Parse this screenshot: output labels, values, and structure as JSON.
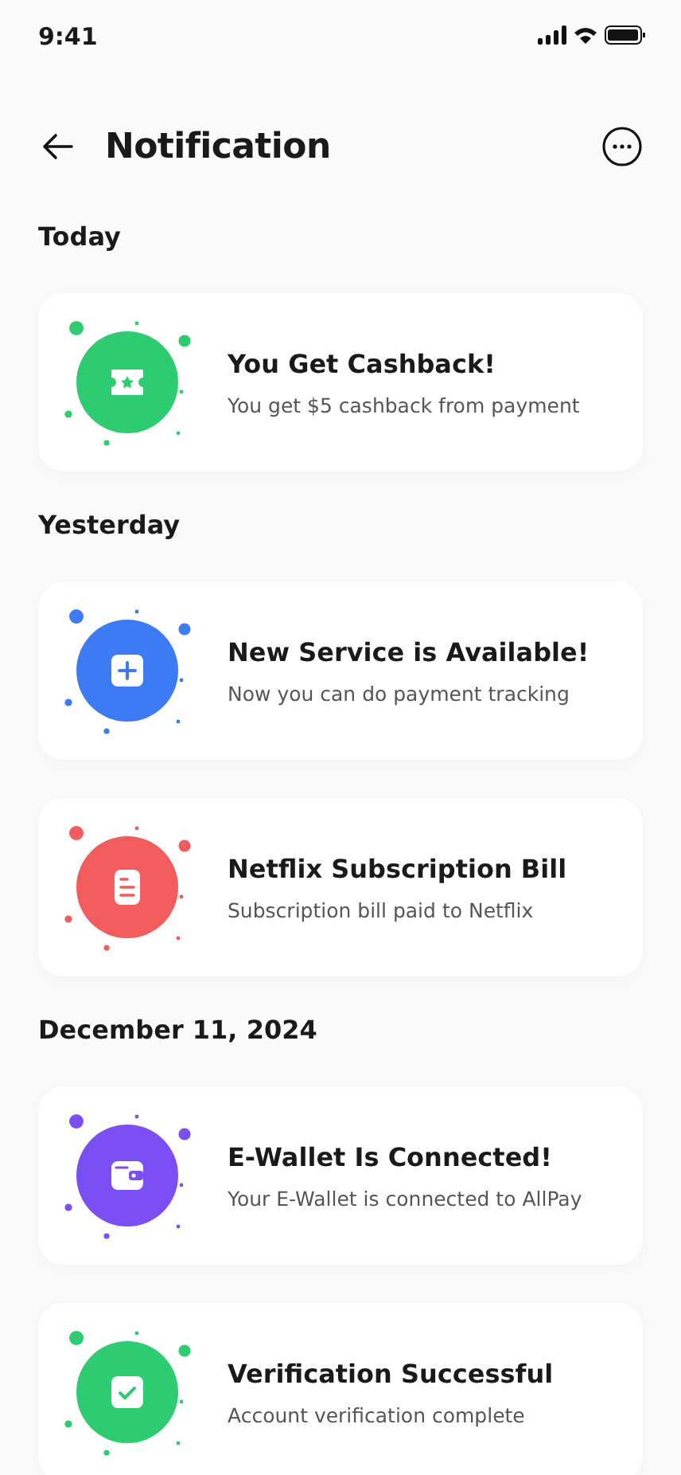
{
  "status_bar": {
    "time": "9:41"
  },
  "header": {
    "title": "Notification"
  },
  "sections": [
    {
      "heading": "Today",
      "items": [
        {
          "kind": "ticket",
          "color": "#2ecc71",
          "title": "You Get Cashback!",
          "message": "You get $5 cashback from payment"
        }
      ]
    },
    {
      "heading": "Yesterday",
      "items": [
        {
          "kind": "plus",
          "color": "#3d7bf5",
          "title": "New Service is Available!",
          "message": "Now you can do payment tracking"
        },
        {
          "kind": "document",
          "color": "#f25c5c",
          "title": "Netflix Subscription Bill",
          "message": "Subscription bill paid to Netflix"
        }
      ]
    },
    {
      "heading": "December 11, 2024",
      "items": [
        {
          "kind": "wallet",
          "color": "#7b4ff5",
          "title": "E-Wallet Is Connected!",
          "message": "Your E-Wallet is connected to AllPay"
        },
        {
          "kind": "check",
          "color": "#2ecc71",
          "title": "Verification Successful",
          "message": "Account verification complete"
        }
      ]
    }
  ]
}
